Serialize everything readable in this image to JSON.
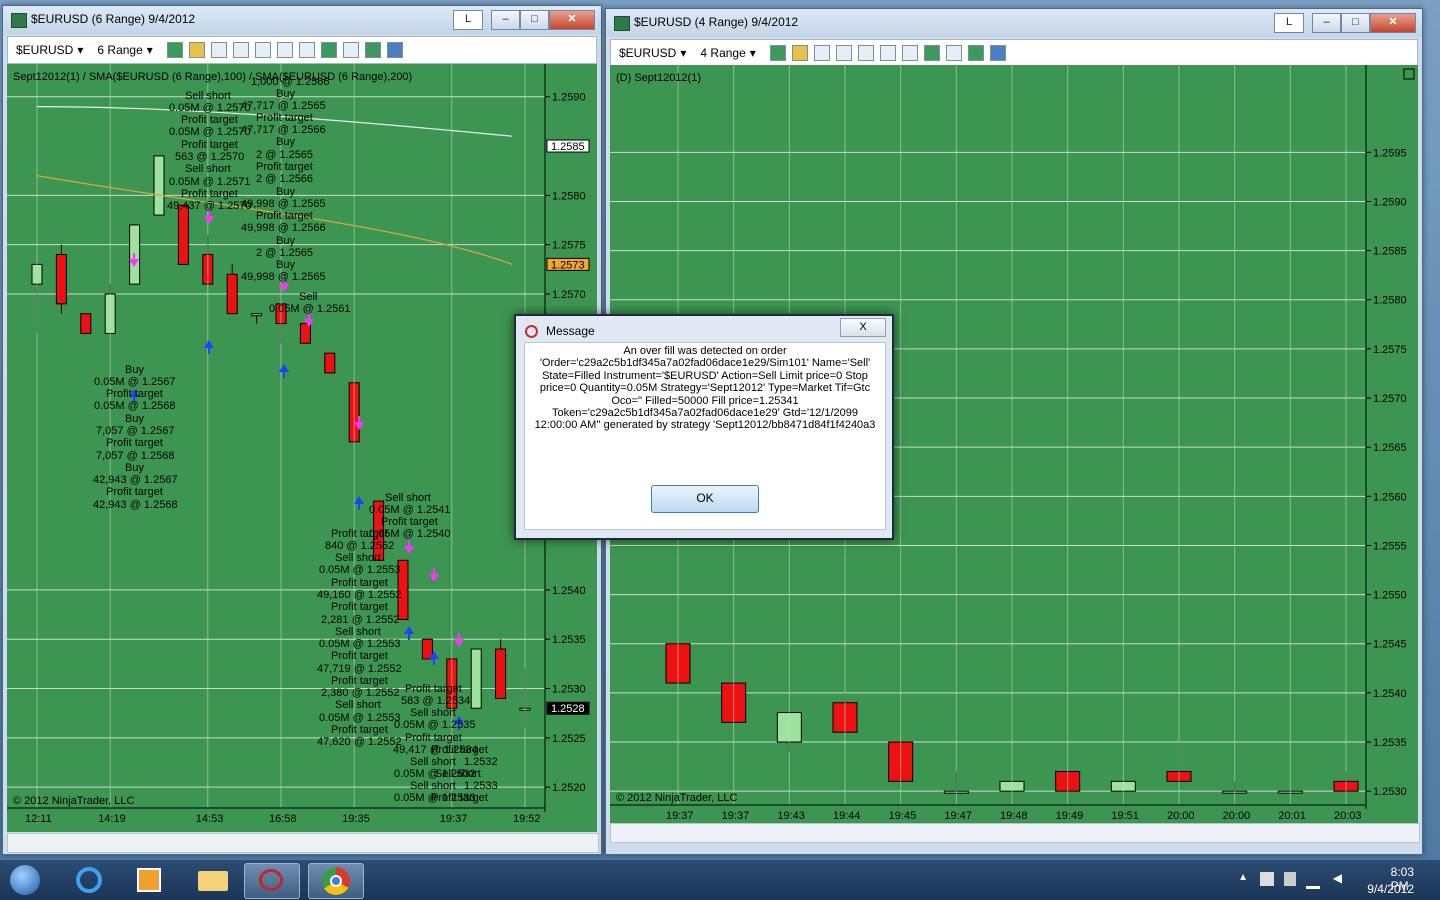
{
  "left_window": {
    "title": "$EURUSD (6 Range)  9/4/2012",
    "toolbar": {
      "instrument": "$EURUSD",
      "period": "6 Range",
      "l_button": "L"
    },
    "indicator_label": "Sept12012(1) / SMA($EURUSD (6 Range),100) / SMA($EURUSD (6 Range),200)",
    "copyright": "© 2012 NinjaTrader, LLC",
    "price_ticks": [
      "1.2590",
      "1.2580",
      "1.2575",
      "1.2570",
      "1.2540",
      "1.2535",
      "1.2530",
      "1.2525",
      "1.2520"
    ],
    "price_tick_values": [
      1.259,
      1.258,
      1.2575,
      1.257,
      1.254,
      1.2535,
      1.253,
      1.2525,
      1.252
    ],
    "price_markers": [
      {
        "label": "1.2585",
        "value": 1.2585,
        "color": "#ffffff",
        "text_color": "#000000"
      },
      {
        "label": "1.2573",
        "value": 1.2573,
        "color": "#f4a431",
        "text_color": "#000000"
      },
      {
        "label": "1.2528",
        "value": 1.2528,
        "color": "#000000",
        "text_color": "#ffffff"
      }
    ],
    "time_ticks": [
      "12:11",
      "14:19",
      "14:53",
      "16:58",
      "19:35",
      "19:37",
      "19:52"
    ],
    "annotations": [
      {
        "text": "1,000 @ 1.2566",
        "x": 250,
        "y": 70
      },
      {
        "text": "Buy",
        "x": 275,
        "y": 82
      },
      {
        "text": "47,717 @ 1.2565",
        "x": 240,
        "y": 94
      },
      {
        "text": "Profit target",
        "x": 255,
        "y": 106
      },
      {
        "text": "47,717 @ 1.2566",
        "x": 240,
        "y": 118
      },
      {
        "text": "Buy",
        "x": 275,
        "y": 130
      },
      {
        "text": "2 @ 1.2565",
        "x": 255,
        "y": 143
      },
      {
        "text": "Profit target",
        "x": 255,
        "y": 155
      },
      {
        "text": "2 @ 1.2566",
        "x": 255,
        "y": 167
      },
      {
        "text": "Buy",
        "x": 275,
        "y": 180
      },
      {
        "text": "49,998 @ 1.2565",
        "x": 240,
        "y": 192
      },
      {
        "text": "Profit target",
        "x": 255,
        "y": 204
      },
      {
        "text": "49,998 @ 1.2566",
        "x": 240,
        "y": 216
      },
      {
        "text": "Buy",
        "x": 275,
        "y": 229
      },
      {
        "text": "2 @ 1.2565",
        "x": 255,
        "y": 241
      },
      {
        "text": "Buy",
        "x": 275,
        "y": 253
      },
      {
        "text": "49,998 @ 1.2565",
        "x": 240,
        "y": 265
      },
      {
        "text": "Sell short",
        "x": 184,
        "y": 84
      },
      {
        "text": "0.05M @ 1.2570",
        "x": 168,
        "y": 96
      },
      {
        "text": "Profit target",
        "x": 180,
        "y": 108
      },
      {
        "text": "0.05M @ 1.2570",
        "x": 168,
        "y": 120
      },
      {
        "text": "Profit target",
        "x": 180,
        "y": 133
      },
      {
        "text": "563 @ 1.2570",
        "x": 174,
        "y": 145
      },
      {
        "text": "Sell short",
        "x": 184,
        "y": 157
      },
      {
        "text": "0.05M @ 1.2571",
        "x": 168,
        "y": 170
      },
      {
        "text": "Profit target",
        "x": 180,
        "y": 182
      },
      {
        "text": "49,437 @ 1.2570",
        "x": 166,
        "y": 194
      },
      {
        "text": "Sell",
        "x": 298,
        "y": 285
      },
      {
        "text": "0.05M @ 1.2561",
        "x": 268,
        "y": 297
      },
      {
        "text": "Buy",
        "x": 124,
        "y": 358
      },
      {
        "text": "0.05M @ 1.2567",
        "x": 93,
        "y": 370
      },
      {
        "text": "Profit target",
        "x": 105,
        "y": 382
      },
      {
        "text": "0.05M @ 1.2568",
        "x": 93,
        "y": 394
      },
      {
        "text": "Buy",
        "x": 124,
        "y": 407
      },
      {
        "text": "7,057 @ 1.2567",
        "x": 95,
        "y": 419
      },
      {
        "text": "Profit target",
        "x": 105,
        "y": 431
      },
      {
        "text": "7,057 @ 1.2568",
        "x": 95,
        "y": 444
      },
      {
        "text": "Buy",
        "x": 124,
        "y": 456
      },
      {
        "text": "42,943 @ 1.2567",
        "x": 92,
        "y": 468
      },
      {
        "text": "Profit target",
        "x": 105,
        "y": 480
      },
      {
        "text": "42,943 @ 1.2568",
        "x": 92,
        "y": 493
      },
      {
        "text": "Sell short",
        "x": 384,
        "y": 486
      },
      {
        "text": "0.05M @ 1.2541",
        "x": 368,
        "y": 498
      },
      {
        "text": "Profit target",
        "x": 380,
        "y": 510
      },
      {
        "text": "Profit target",
        "x": 330,
        "y": 522
      },
      {
        "text": "0.05M @ 1.2540",
        "x": 368,
        "y": 522
      },
      {
        "text": "840 @ 1.2552",
        "x": 324,
        "y": 534
      },
      {
        "text": "Sell short",
        "x": 334,
        "y": 546
      },
      {
        "text": "0.05M @ 1.2553",
        "x": 318,
        "y": 558
      },
      {
        "text": "Profit target",
        "x": 330,
        "y": 571
      },
      {
        "text": "49,160 @ 1.2552",
        "x": 316,
        "y": 583
      },
      {
        "text": "Profit target",
        "x": 330,
        "y": 595
      },
      {
        "text": "2,281 @ 1.2552",
        "x": 320,
        "y": 608
      },
      {
        "text": "Sell short",
        "x": 334,
        "y": 620
      },
      {
        "text": "0.05M @ 1.2553",
        "x": 318,
        "y": 632
      },
      {
        "text": "Profit target",
        "x": 330,
        "y": 644
      },
      {
        "text": "47,719 @ 1.2552",
        "x": 316,
        "y": 657
      },
      {
        "text": "Profit target",
        "x": 330,
        "y": 669
      },
      {
        "text": "2,380 @ 1.2552",
        "x": 320,
        "y": 681
      },
      {
        "text": "Sell short",
        "x": 334,
        "y": 693
      },
      {
        "text": "0.05M @ 1.2553",
        "x": 318,
        "y": 706
      },
      {
        "text": "Profit target",
        "x": 330,
        "y": 718
      },
      {
        "text": "47,620 @ 1.2552",
        "x": 316,
        "y": 730
      },
      {
        "text": "Profit target",
        "x": 404,
        "y": 677
      },
      {
        "text": "583 @ 1.2534",
        "x": 400,
        "y": 689
      },
      {
        "text": "Sell short",
        "x": 409,
        "y": 701
      },
      {
        "text": "0.05M @ 1.2535",
        "x": 393,
        "y": 713
      },
      {
        "text": "Profit target",
        "x": 404,
        "y": 726
      },
      {
        "text": "49,417 @ 1.2534",
        "x": 392,
        "y": 738
      },
      {
        "text": "Sell short",
        "x": 409,
        "y": 750
      },
      {
        "text": "0.05M @ 1.2532",
        "x": 393,
        "y": 762
      },
      {
        "text": "Sell short",
        "x": 409,
        "y": 774
      },
      {
        "text": "0.05M @ 1.2533",
        "x": 393,
        "y": 786
      },
      {
        "text": "Profit target",
        "x": 430,
        "y": 738
      },
      {
        "text": "Sell short",
        "x": 434,
        "y": 762
      },
      {
        "text": "1.2532",
        "x": 463,
        "y": 750
      },
      {
        "text": "1.2533",
        "x": 463,
        "y": 774
      },
      {
        "text": "Profit target",
        "x": 430,
        "y": 786
      }
    ]
  },
  "right_window": {
    "title": "$EURUSD (4 Range)  9/4/2012",
    "toolbar": {
      "instrument": "$EURUSD",
      "period": "4 Range",
      "l_button": "L"
    },
    "indicator_label": "(D) Sept12012(1)",
    "copyright": "© 2012 NinjaTrader, LLC",
    "price_ticks": [
      "1.2595",
      "1.2590",
      "1.2585",
      "1.2580",
      "1.2575",
      "1.2570",
      "1.2565",
      "1.2560",
      "1.2555",
      "1.2550",
      "1.2545",
      "1.2540",
      "1.2535",
      "1.2530"
    ],
    "price_tick_values": [
      1.2595,
      1.259,
      1.2585,
      1.258,
      1.2575,
      1.257,
      1.2565,
      1.256,
      1.2555,
      1.255,
      1.2545,
      1.254,
      1.2535,
      1.253
    ],
    "time_ticks": [
      "19:37",
      "19:37",
      "19:43",
      "19:44",
      "19:45",
      "19:47",
      "19:48",
      "19:49",
      "19:51",
      "20:00",
      "20:00",
      "20:01",
      "20:03"
    ]
  },
  "chart_data": [
    {
      "type": "candlestick",
      "title": "$EURUSD (6 Range)",
      "ylim": [
        1.2519,
        1.2592
      ],
      "candles": [
        {
          "t": "12:11",
          "o": 1.2571,
          "h": 1.2573,
          "l": 1.2566,
          "c": 1.2573
        },
        {
          "t": "",
          "o": 1.2574,
          "h": 1.2575,
          "l": 1.2568,
          "c": 1.2569
        },
        {
          "t": "",
          "o": 1.2568,
          "h": 1.2568,
          "l": 1.2566,
          "c": 1.2566
        },
        {
          "t": "14:19",
          "o": 1.2566,
          "h": 1.2571,
          "l": 1.2566,
          "c": 1.257
        },
        {
          "t": "",
          "o": 1.2571,
          "h": 1.2577,
          "l": 1.2571,
          "c": 1.2577
        },
        {
          "t": "",
          "o": 1.2578,
          "h": 1.2584,
          "l": 1.2578,
          "c": 1.2584
        },
        {
          "t": "14:53",
          "o": 1.2579,
          "h": 1.2579,
          "l": 1.2573,
          "c": 1.2573
        },
        {
          "t": "",
          "o": 1.2574,
          "h": 1.2576,
          "l": 1.2571,
          "c": 1.2571
        },
        {
          "t": "",
          "o": 1.2572,
          "h": 1.2573,
          "l": 1.2568,
          "c": 1.2568
        },
        {
          "t": "16:58",
          "o": 1.2568,
          "h": 1.2568,
          "l": 1.2567,
          "c": 1.2568
        },
        {
          "t": "",
          "o": 1.2569,
          "h": 1.2569,
          "l": 1.2565,
          "c": 1.2567
        },
        {
          "t": "",
          "o": 1.2567,
          "h": 1.2567,
          "l": 1.2565,
          "c": 1.2565
        },
        {
          "t": "",
          "o": 1.2564,
          "h": 1.2564,
          "l": 1.2562,
          "c": 1.2562
        },
        {
          "t": "19:35",
          "o": 1.2561,
          "h": 1.2561,
          "l": 1.2555,
          "c": 1.2555
        },
        {
          "t": "",
          "o": 1.2549,
          "h": 1.2549,
          "l": 1.2543,
          "c": 1.2543
        },
        {
          "t": "19:37",
          "o": 1.2543,
          "h": 1.2543,
          "l": 1.2537,
          "c": 1.2537
        },
        {
          "t": "",
          "o": 1.2535,
          "h": 1.2535,
          "l": 1.2533,
          "c": 1.2533
        },
        {
          "t": "",
          "o": 1.2533,
          "h": 1.2533,
          "l": 1.2528,
          "c": 1.2528
        },
        {
          "t": "19:52",
          "o": 1.2528,
          "h": 1.2534,
          "l": 1.2528,
          "c": 1.2534
        },
        {
          "t": "",
          "o": 1.2534,
          "h": 1.2535,
          "l": 1.2529,
          "c": 1.2529
        },
        {
          "t": "",
          "o": 1.2528,
          "h": 1.2532,
          "l": 1.2526,
          "c": 1.2528
        }
      ]
    },
    {
      "type": "candlestick",
      "title": "$EURUSD (4 Range)",
      "ylim": [
        1.2529,
        1.2599
      ],
      "candles": [
        {
          "t": "19:37",
          "o": 1.2545,
          "h": 1.2545,
          "l": 1.2541,
          "c": 1.2541
        },
        {
          "t": "19:37",
          "o": 1.2541,
          "h": 1.2541,
          "l": 1.2537,
          "c": 1.2537
        },
        {
          "t": "19:43",
          "o": 1.2535,
          "h": 1.2538,
          "l": 1.2534,
          "c": 1.2538
        },
        {
          "t": "19:44",
          "o": 1.2539,
          "h": 1.254,
          "l": 1.2536,
          "c": 1.2536
        },
        {
          "t": "19:45",
          "o": 1.2535,
          "h": 1.2535,
          "l": 1.2531,
          "c": 1.2531
        },
        {
          "t": "19:47",
          "o": 1.253,
          "h": 1.2532,
          "l": 1.253,
          "c": 1.253
        },
        {
          "t": "19:48",
          "o": 1.253,
          "h": 1.2531,
          "l": 1.253,
          "c": 1.2531
        },
        {
          "t": "19:49",
          "o": 1.2532,
          "h": 1.2532,
          "l": 1.253,
          "c": 1.253
        },
        {
          "t": "19:51",
          "o": 1.253,
          "h": 1.2531,
          "l": 1.253,
          "c": 1.2531
        },
        {
          "t": "20:00",
          "o": 1.2532,
          "h": 1.2535,
          "l": 1.2531,
          "c": 1.2531
        },
        {
          "t": "20:00",
          "o": 1.253,
          "h": 1.2531,
          "l": 1.253,
          "c": 1.253
        },
        {
          "t": "20:01",
          "o": 1.253,
          "h": 1.253,
          "l": 1.253,
          "c": 1.253
        },
        {
          "t": "20:03",
          "o": 1.2531,
          "h": 1.2532,
          "l": 1.253,
          "c": 1.253
        }
      ]
    }
  ],
  "dialog": {
    "title": "Message",
    "message": "An over fill was detected on order\n'Order='c29a2c5b1df345a7a02fad06dace1e29/Sim101' Name='Sell'\nState=Filled Instrument='$EURUSD' Action=Sell Limit price=0 Stop\nprice=0 Quantity=0.05M Strategy='Sept12012' Type=Market Tif=Gtc\nOco='' Filled=50000 Fill price=1.25341\nToken='c29a2c5b1df345a7a02fad06dace1e29' Gtd='12/1/2099\n12:00:00 AM'' generated by strategy 'Sept12012/bb8471d84f1f4240a3",
    "ok_label": "OK",
    "close_glyph": "X"
  },
  "taskbar": {
    "time": "8:03 PM",
    "date": "9/4/2012",
    "apps": [
      "start-orb",
      "internet-explorer",
      "media-player",
      "file-explorer",
      "ninjatrader",
      "chrome"
    ]
  },
  "colors": {
    "chart_bg": "#3c9652",
    "bull": "#9de39e",
    "bear": "#ee1111",
    "grid": "#c8ddc8"
  }
}
